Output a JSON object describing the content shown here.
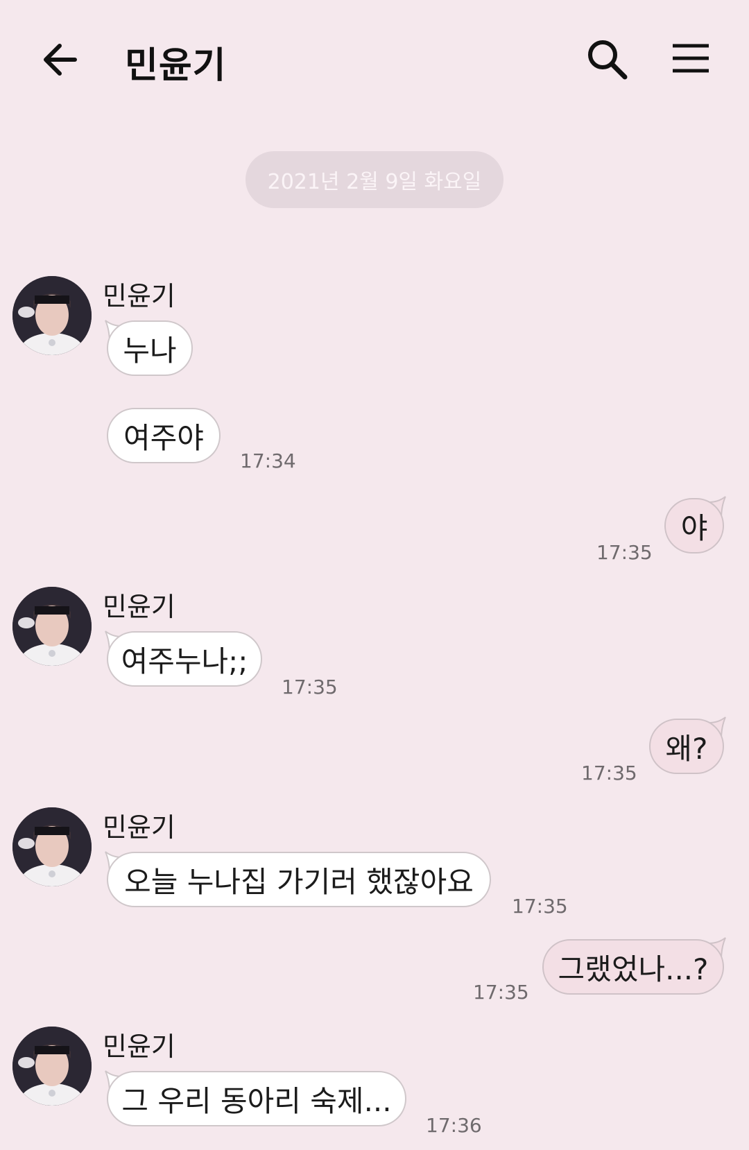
{
  "header": {
    "title": "민윤기"
  },
  "date_divider": "2021년 2월 9일 화요일",
  "messages": [
    {
      "sender": "민윤기",
      "text": "누나"
    },
    {
      "text": "여주야",
      "time": "17:34"
    },
    {
      "text": "야",
      "time": "17:35"
    },
    {
      "sender": "민윤기",
      "text": "여주누나;;",
      "time": "17:35"
    },
    {
      "text": "왜?",
      "time": "17:35"
    },
    {
      "sender": "민윤기",
      "text": "오늘 누나집 가기러 했잖아요",
      "time": "17:35"
    },
    {
      "text": "그랬었나...?",
      "time": "17:35"
    },
    {
      "sender": "민윤기",
      "text": "그 우리 동아리 숙제...",
      "time": "17:36"
    }
  ],
  "icons": {
    "back": "back-arrow-icon",
    "search": "search-icon",
    "menu": "menu-icon"
  },
  "colors": {
    "background": "#f5e8ed",
    "incoming_bubble": "#ffffff",
    "outgoing_bubble": "#f3dfe5"
  }
}
